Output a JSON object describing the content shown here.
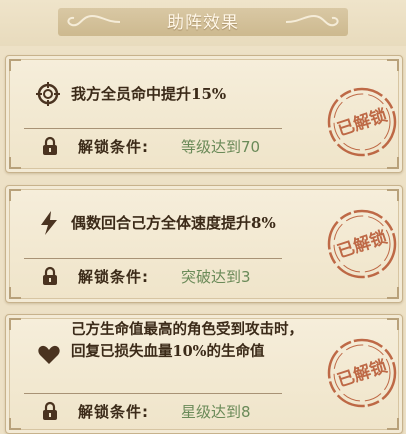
{
  "header": {
    "title": "助阵效果"
  },
  "cards": [
    {
      "icon": "target-icon",
      "effect": "我方全员命中提升15%",
      "condition_label": "解锁条件:",
      "condition_value": "等级达到70",
      "stamp": "已解锁"
    },
    {
      "icon": "lightning-icon",
      "effect": "偶数回合己方全体速度提升8%",
      "condition_label": "解锁条件:",
      "condition_value": "突破达到3",
      "stamp": "已解锁"
    },
    {
      "icon": "heart-icon",
      "effect": "己方生命值最高的角色受到攻击时，回复已损失血量10%的生命值",
      "condition_label": "解锁条件:",
      "condition_value": "星级达到8",
      "stamp": "已解锁"
    }
  ],
  "colors": {
    "stamp_red": "#b5532e",
    "value_green": "#6a8a58",
    "text_dark": "#3b2a18"
  }
}
